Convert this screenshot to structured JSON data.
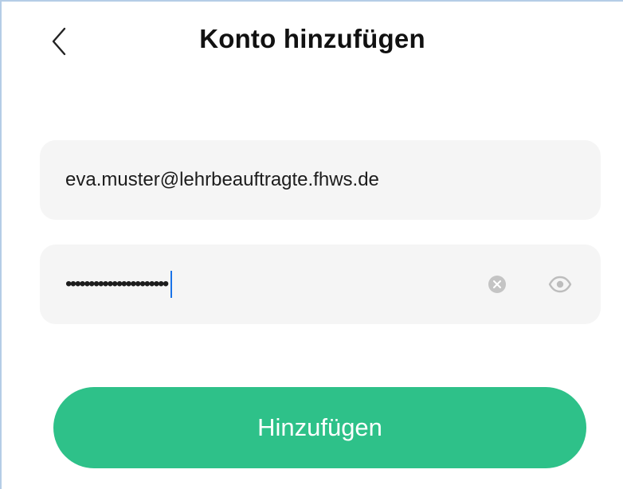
{
  "header": {
    "title": "Konto hinzufügen",
    "back_icon": "chevron-left-icon"
  },
  "form": {
    "email": {
      "value": "eva.muster@lehrbeauftragte.fhws.de"
    },
    "password": {
      "masked_value": "••••••••••••••••••••••",
      "clear_icon": "clear-icon",
      "visibility_icon": "eye-icon"
    },
    "submit_label": "Hinzufügen"
  },
  "colors": {
    "accent": "#2ec189",
    "field_background": "#f5f5f5",
    "caret": "#1a73e8",
    "icon_gray": "#c4c4c4"
  }
}
